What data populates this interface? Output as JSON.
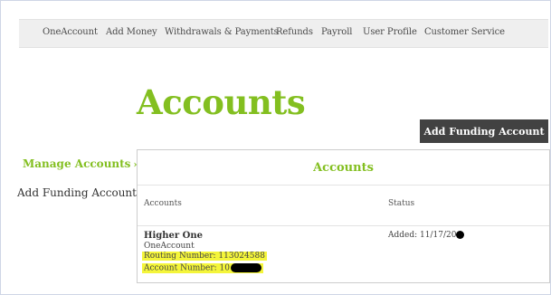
{
  "nav": {
    "items": [
      {
        "label": "OneAccount"
      },
      {
        "label": "Add Money"
      },
      {
        "label": "Withdrawals & Payments"
      },
      {
        "label": "Refunds"
      },
      {
        "label": "Payroll"
      },
      {
        "label": "User Profile"
      },
      {
        "label": "Customer Service"
      }
    ]
  },
  "page": {
    "title": "Accounts",
    "add_button": "Add Funding Account"
  },
  "sidebar": {
    "manage": "Manage Accounts",
    "manage_chevron": "›",
    "add": "Add Funding Account"
  },
  "panel": {
    "title": "Accounts",
    "columns": {
      "accounts": "Accounts",
      "status": "Status"
    },
    "row": {
      "name": "Higher One",
      "type": "OneAccount",
      "routing": "Routing Number: 113024588",
      "account_prefix": "Account Number: 10",
      "added": "Added: 11/17/20"
    }
  },
  "colors": {
    "brand_green": "#83bf20",
    "highlight": "#f4f53a",
    "button_bg": "#424242"
  }
}
